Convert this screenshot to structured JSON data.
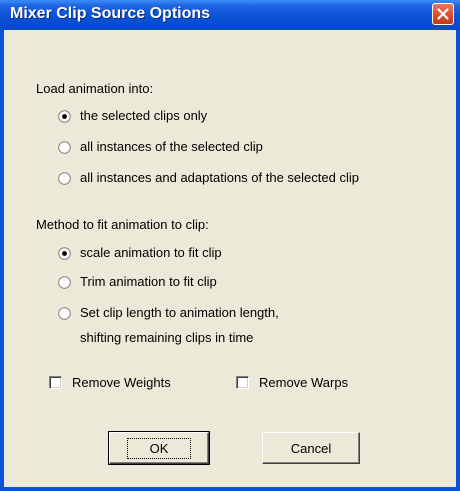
{
  "dialog": {
    "title": "Mixer Clip Source Options",
    "accent": "#0a52d8",
    "close_color": "#d94a2a"
  },
  "load_group": {
    "label": "Load animation into:",
    "options": [
      {
        "label": "the selected clips only",
        "selected": true
      },
      {
        "label": "all instances of the selected clip",
        "selected": false
      },
      {
        "label": "all instances and adaptations of the selected clip",
        "selected": false
      }
    ]
  },
  "method_group": {
    "label": "Method to fit animation to clip:",
    "options": [
      {
        "label": "scale animation to fit clip",
        "selected": true
      },
      {
        "label": "Trim animation to fit clip",
        "selected": false
      },
      {
        "label": "Set clip length to animation length,",
        "line2": "shifting remaining clips in time",
        "selected": false
      }
    ]
  },
  "checkboxes": {
    "remove_weights": {
      "label": "Remove Weights",
      "checked": false
    },
    "remove_warps": {
      "label": "Remove Warps",
      "checked": false
    }
  },
  "buttons": {
    "ok": "OK",
    "cancel": "Cancel"
  },
  "icons": {
    "close": "close-icon"
  }
}
